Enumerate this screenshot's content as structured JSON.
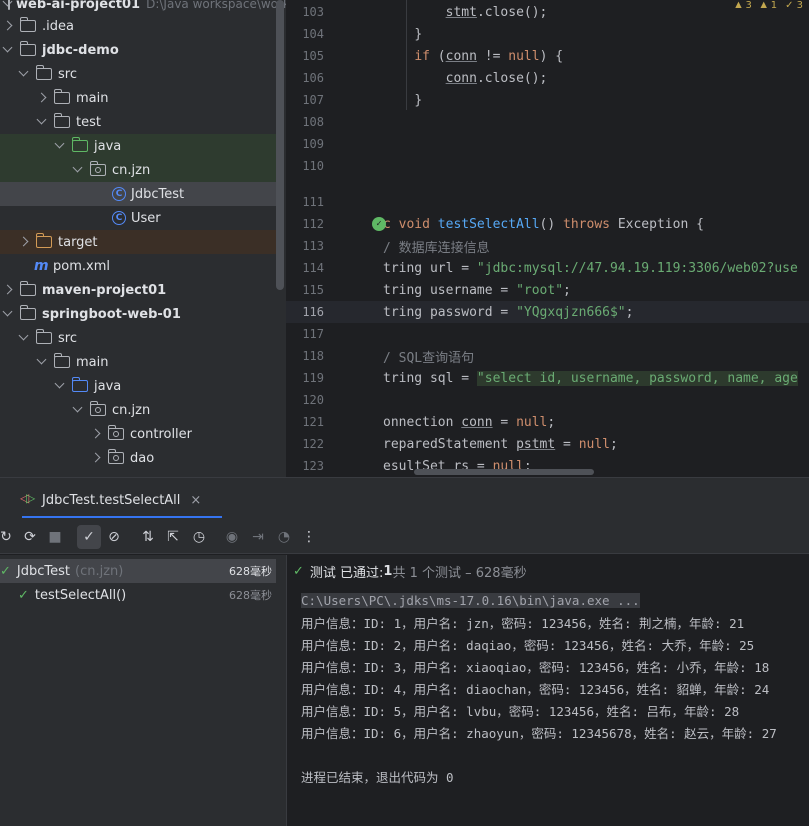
{
  "project_tree": {
    "rows": [
      {
        "label": "web-ai-project01",
        "path": "D:\\Java workspace\\work"
      },
      {
        "label": ".idea"
      },
      {
        "label": "jdbc-demo"
      },
      {
        "label": "src"
      },
      {
        "label": "main"
      },
      {
        "label": "test"
      },
      {
        "label": "java"
      },
      {
        "label": "cn.jzn"
      },
      {
        "label": "JdbcTest"
      },
      {
        "label": "User"
      },
      {
        "label": "target"
      },
      {
        "label": "pom.xml"
      },
      {
        "label": "maven-project01"
      },
      {
        "label": "springboot-web-01"
      },
      {
        "label": "src"
      },
      {
        "label": "main"
      },
      {
        "label": "java"
      },
      {
        "label": "cn.jzn"
      },
      {
        "label": "controller"
      },
      {
        "label": "dao"
      }
    ]
  },
  "editor": {
    "inspections": [
      "▲ 3",
      "▲ 1",
      "✓ 3"
    ],
    "lines": [
      {
        "n": "103"
      },
      {
        "n": "104"
      },
      {
        "n": "105"
      },
      {
        "n": "106"
      },
      {
        "n": "107"
      },
      {
        "n": "108"
      },
      {
        "n": "109"
      },
      {
        "n": "110"
      },
      {
        "n": "111"
      },
      {
        "n": "112"
      },
      {
        "n": "113"
      },
      {
        "n": "114"
      },
      {
        "n": "115"
      },
      {
        "n": "116"
      },
      {
        "n": "117"
      },
      {
        "n": "118"
      },
      {
        "n": "119"
      },
      {
        "n": "120"
      },
      {
        "n": "121"
      },
      {
        "n": "122"
      },
      {
        "n": "123"
      }
    ],
    "code": {
      "l103a": "stmt",
      "l103b": ".close();",
      "l104": "}",
      "l105a": "if",
      "l105b": " (",
      "l105c": "conn",
      "l105d": " != ",
      "l105e": "null",
      "l105f": ") {",
      "l106a": "conn",
      "l106b": ".close();",
      "l107": "}",
      "l112a": "c ",
      "l112b": "void",
      "l112c": " ",
      "l112d": "testSelectAll",
      "l112e": "() ",
      "l112f": "throws",
      "l112g": " Exception {",
      "l113": "/ 数据库连接信息",
      "l114a": "tring url = ",
      "l114b": "\"jdbc:mysql://47.94.19.119:3306/web02?use",
      "l115a": "tring username = ",
      "l115b": "\"root\"",
      "l115c": ";",
      "l116a": "tring password = ",
      "l116b": "\"YQgxqjzn666$\"",
      "l116c": ";",
      "l118": "/ SQL查询语句",
      "l119a": "tring sql = ",
      "l119b": "\"select id, username, password, name, age",
      "l121a": "onnection ",
      "l121b": "conn",
      "l121c": " = ",
      "l121d": "null",
      "l121e": ";",
      "l122a": "reparedStatement ",
      "l122b": "pstmt",
      "l122c": " = ",
      "l122d": "null",
      "l122e": ";",
      "l123a": "esultSet ",
      "l123b": "rs",
      "l123c": " = ",
      "l123d": "null",
      "l123e": ";"
    }
  },
  "run_tab": {
    "title": "JdbcTest.testSelectAll",
    "close": "×"
  },
  "toolbar": {
    "icons": [
      "rerun-icon",
      "rerun-failed-icon",
      "stop-icon",
      "show-passed-icon",
      "show-ignored-icon",
      "sort-icon",
      "collapse-icon",
      "history-icon",
      "camera-icon",
      "import-icon",
      "speed-icon",
      "more-icon"
    ],
    "glyphs": [
      "↻",
      "⟳",
      "■",
      "✓",
      "⊘",
      "⇅",
      "⇱",
      "◷",
      "◉",
      "⇥",
      "◔",
      "⋮"
    ]
  },
  "test_tree": {
    "items": [
      {
        "label": "JdbcTest",
        "pkg": "(cn.jzn)",
        "duration": "628毫秒"
      },
      {
        "label": "testSelectAll()",
        "duration": "628毫秒"
      }
    ]
  },
  "console": {
    "status_check": "✓",
    "status_prefix": "测试 已通过: ",
    "status_count": "1",
    "status_suffix": "共 1 个测试 – 628毫秒",
    "command": "C:\\Users\\PC\\.jdks\\ms-17.0.16\\bin\\java.exe ...",
    "lines": [
      "用户信息：ID: 1，用户名: jzn，密码: 123456，姓名: 荆之楠，年龄: 21",
      "用户信息：ID: 2，用户名: daqiao，密码: 123456，姓名: 大乔，年龄: 25",
      "用户信息：ID: 3，用户名: xiaoqiao，密码: 123456，姓名: 小乔，年龄: 18",
      "用户信息：ID: 4，用户名: diaochan，密码: 123456，姓名: 貂蝉，年龄: 24",
      "用户信息：ID: 5，用户名: lvbu，密码: 123456，姓名: 吕布，年龄: 28",
      "用户信息：ID: 6，用户名: zhaoyun，密码: 12345678，姓名: 赵云，年龄: 27"
    ],
    "exit": "进程已结束，退出代码为 0"
  }
}
